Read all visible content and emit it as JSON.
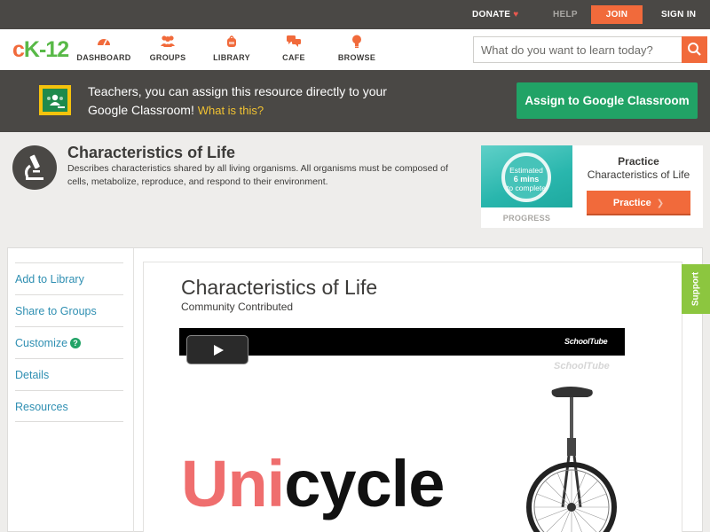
{
  "topbar": {
    "donate": "DONATE",
    "help": "HELP",
    "join": "JOIN",
    "signin": "SIGN IN"
  },
  "nav": {
    "logo": "ck-12",
    "items": [
      {
        "label": "DASHBOARD",
        "icon": "gauge-icon"
      },
      {
        "label": "GROUPS",
        "icon": "people-icon"
      },
      {
        "label": "LIBRARY",
        "icon": "backpack-icon"
      },
      {
        "label": "CAFE",
        "icon": "chat-bubbles-icon"
      },
      {
        "label": "BROWSE",
        "icon": "lightbulb-icon"
      }
    ],
    "search_placeholder": "What do you want to learn today?"
  },
  "banner": {
    "text": "Teachers, you can assign this resource directly to your Google Classroom!",
    "link": "What is this?",
    "button": "Assign to Google Classroom"
  },
  "resource": {
    "title": "Characteristics of Life",
    "description": "Describes characteristics shared by all living organisms. All organisms must be composed of cells, metabolize, reproduce, and respond to their environment."
  },
  "practice": {
    "estimate_line1": "Estimated",
    "estimate_line2": "6 mins",
    "estimate_line3": "to complete",
    "progress_label": "PROGRESS",
    "heading": "Practice",
    "subtitle": "Characteristics of Life",
    "button": "Practice"
  },
  "sidebar": {
    "items": [
      "Add to Library",
      "Share to Groups",
      "Customize",
      "Details",
      "Resources"
    ]
  },
  "content": {
    "title": "Characteristics of Life",
    "subtitle": "Community Contributed",
    "video": {
      "logo": "SchoolTube",
      "word_red": "Uni",
      "word_black": "cycle"
    }
  },
  "support": "Support",
  "colors": {
    "brand_orange": "#f16a3b",
    "brand_green": "#58b947",
    "dark_bar": "#4a4845",
    "google_green": "#21a366",
    "link_blue": "#2f8fb2"
  }
}
